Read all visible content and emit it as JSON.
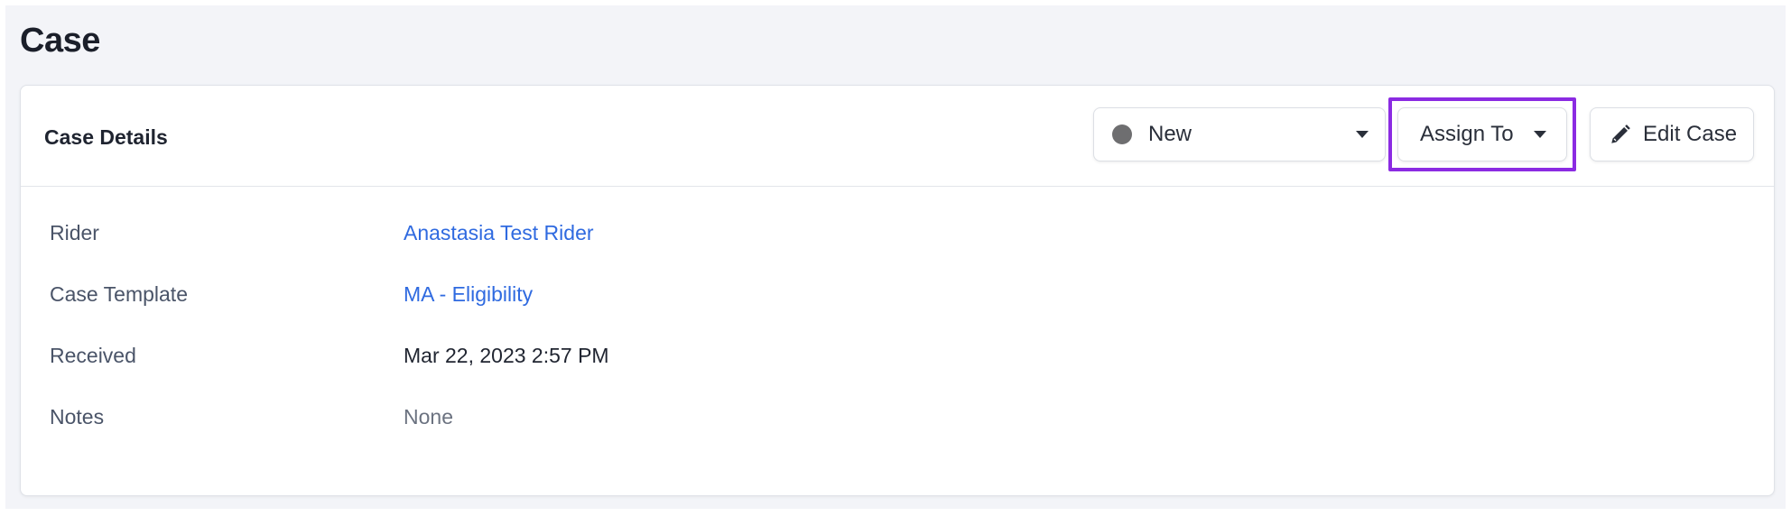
{
  "page": {
    "title": "Case"
  },
  "card": {
    "title": "Case Details",
    "status": {
      "label": "New",
      "dot_color": "#6e6e70"
    },
    "assign": {
      "label": "Assign To",
      "highlight_color": "#8b2be2"
    },
    "edit": {
      "label": "Edit Case"
    }
  },
  "details": [
    {
      "label": "Rider",
      "value": "Anastasia Test Rider",
      "kind": "link"
    },
    {
      "label": "Case Template",
      "value": "MA - Eligibility",
      "kind": "link"
    },
    {
      "label": "Received",
      "value": "Mar 22, 2023 2:57 PM",
      "kind": "plain"
    },
    {
      "label": "Notes",
      "value": "None",
      "kind": "muted"
    }
  ],
  "colors": {
    "link": "#2f6ae0",
    "background": "#f3f4f8"
  }
}
